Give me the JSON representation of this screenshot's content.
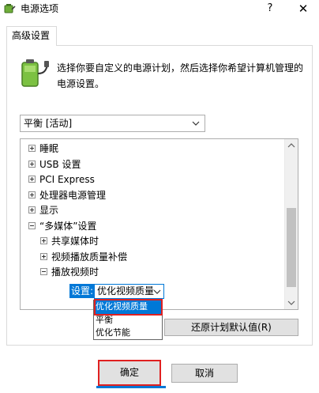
{
  "window": {
    "title": "电源选项",
    "help_label": "?",
    "close_label": "✕"
  },
  "tab": {
    "label": "高级设置"
  },
  "description": "选择你要自定义的电源计划，然后选择你希望计算机管理的电源设置。",
  "plan_select": {
    "value": "平衡 [活动]"
  },
  "tree": {
    "items": [
      {
        "label": "睡眠",
        "indent": 0,
        "expander": "plus"
      },
      {
        "label": "USB 设置",
        "indent": 0,
        "expander": "plus"
      },
      {
        "label": "PCI Express",
        "indent": 0,
        "expander": "plus"
      },
      {
        "label": "处理器电源管理",
        "indent": 0,
        "expander": "plus"
      },
      {
        "label": "显示",
        "indent": 0,
        "expander": "plus"
      },
      {
        "label": "“多媒体”设置",
        "indent": 0,
        "expander": "minus"
      },
      {
        "label": "共享媒体时",
        "indent": 1,
        "expander": "plus"
      },
      {
        "label": "视频播放质量补偿",
        "indent": 1,
        "expander": "plus"
      },
      {
        "label": "播放视频时",
        "indent": 1,
        "expander": "minus"
      }
    ]
  },
  "setting": {
    "label": "设置:",
    "value": "优化视频质量",
    "options": [
      "优化视频质量",
      "平衡",
      "优化节能"
    ]
  },
  "buttons": {
    "restore": "还原计划默认值(R)",
    "ok": "确定",
    "cancel": "取消"
  },
  "colors": {
    "accent": "#0078d7",
    "annotation_red": "#e02020"
  }
}
